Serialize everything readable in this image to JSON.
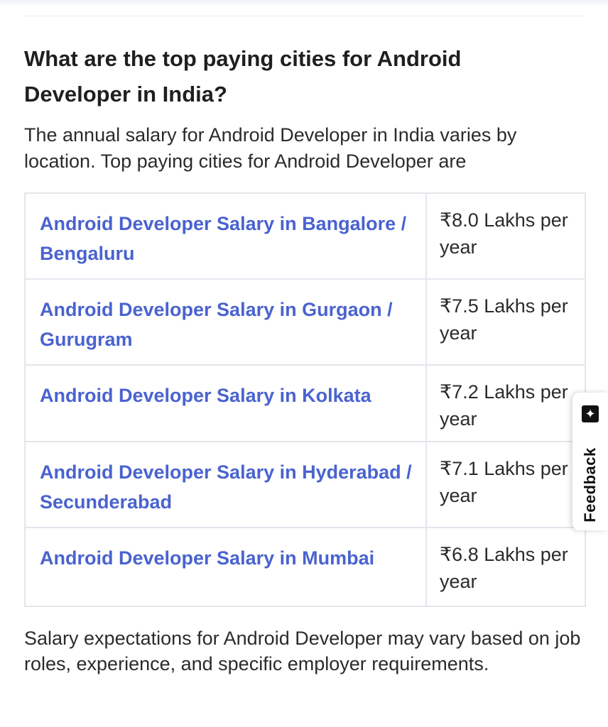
{
  "section": {
    "heading": "What are the top paying cities for Android Developer in India?",
    "intro": "The annual salary for Android Developer in India varies by location. Top paying cities for Android Developer are",
    "footer": "Salary expectations for Android Developer may vary based on job roles, experience, and specific employer requirements."
  },
  "table": {
    "rows": [
      {
        "city_link": "Android Developer Salary in Bangalore / Bengaluru",
        "salary": "₹8.0 Lakhs per year"
      },
      {
        "city_link": "Android Developer Salary in Gurgaon / Gurugram",
        "salary": "₹7.5 Lakhs per year"
      },
      {
        "city_link": "Android Developer Salary in Kolkata",
        "salary": "₹7.2 Lakhs per year"
      },
      {
        "city_link": "Android Developer Salary in Hyderabad / Secunderabad",
        "salary": "₹7.1 Lakhs per year"
      },
      {
        "city_link": "Android Developer Salary in Mumbai",
        "salary": "₹6.8 Lakhs per year"
      }
    ]
  },
  "feedback": {
    "label": "Feedback",
    "icon": "sparkle-icon"
  },
  "colors": {
    "link": "#4a63cf",
    "text": "#1f1f1f",
    "border": "#e3e6ec"
  }
}
